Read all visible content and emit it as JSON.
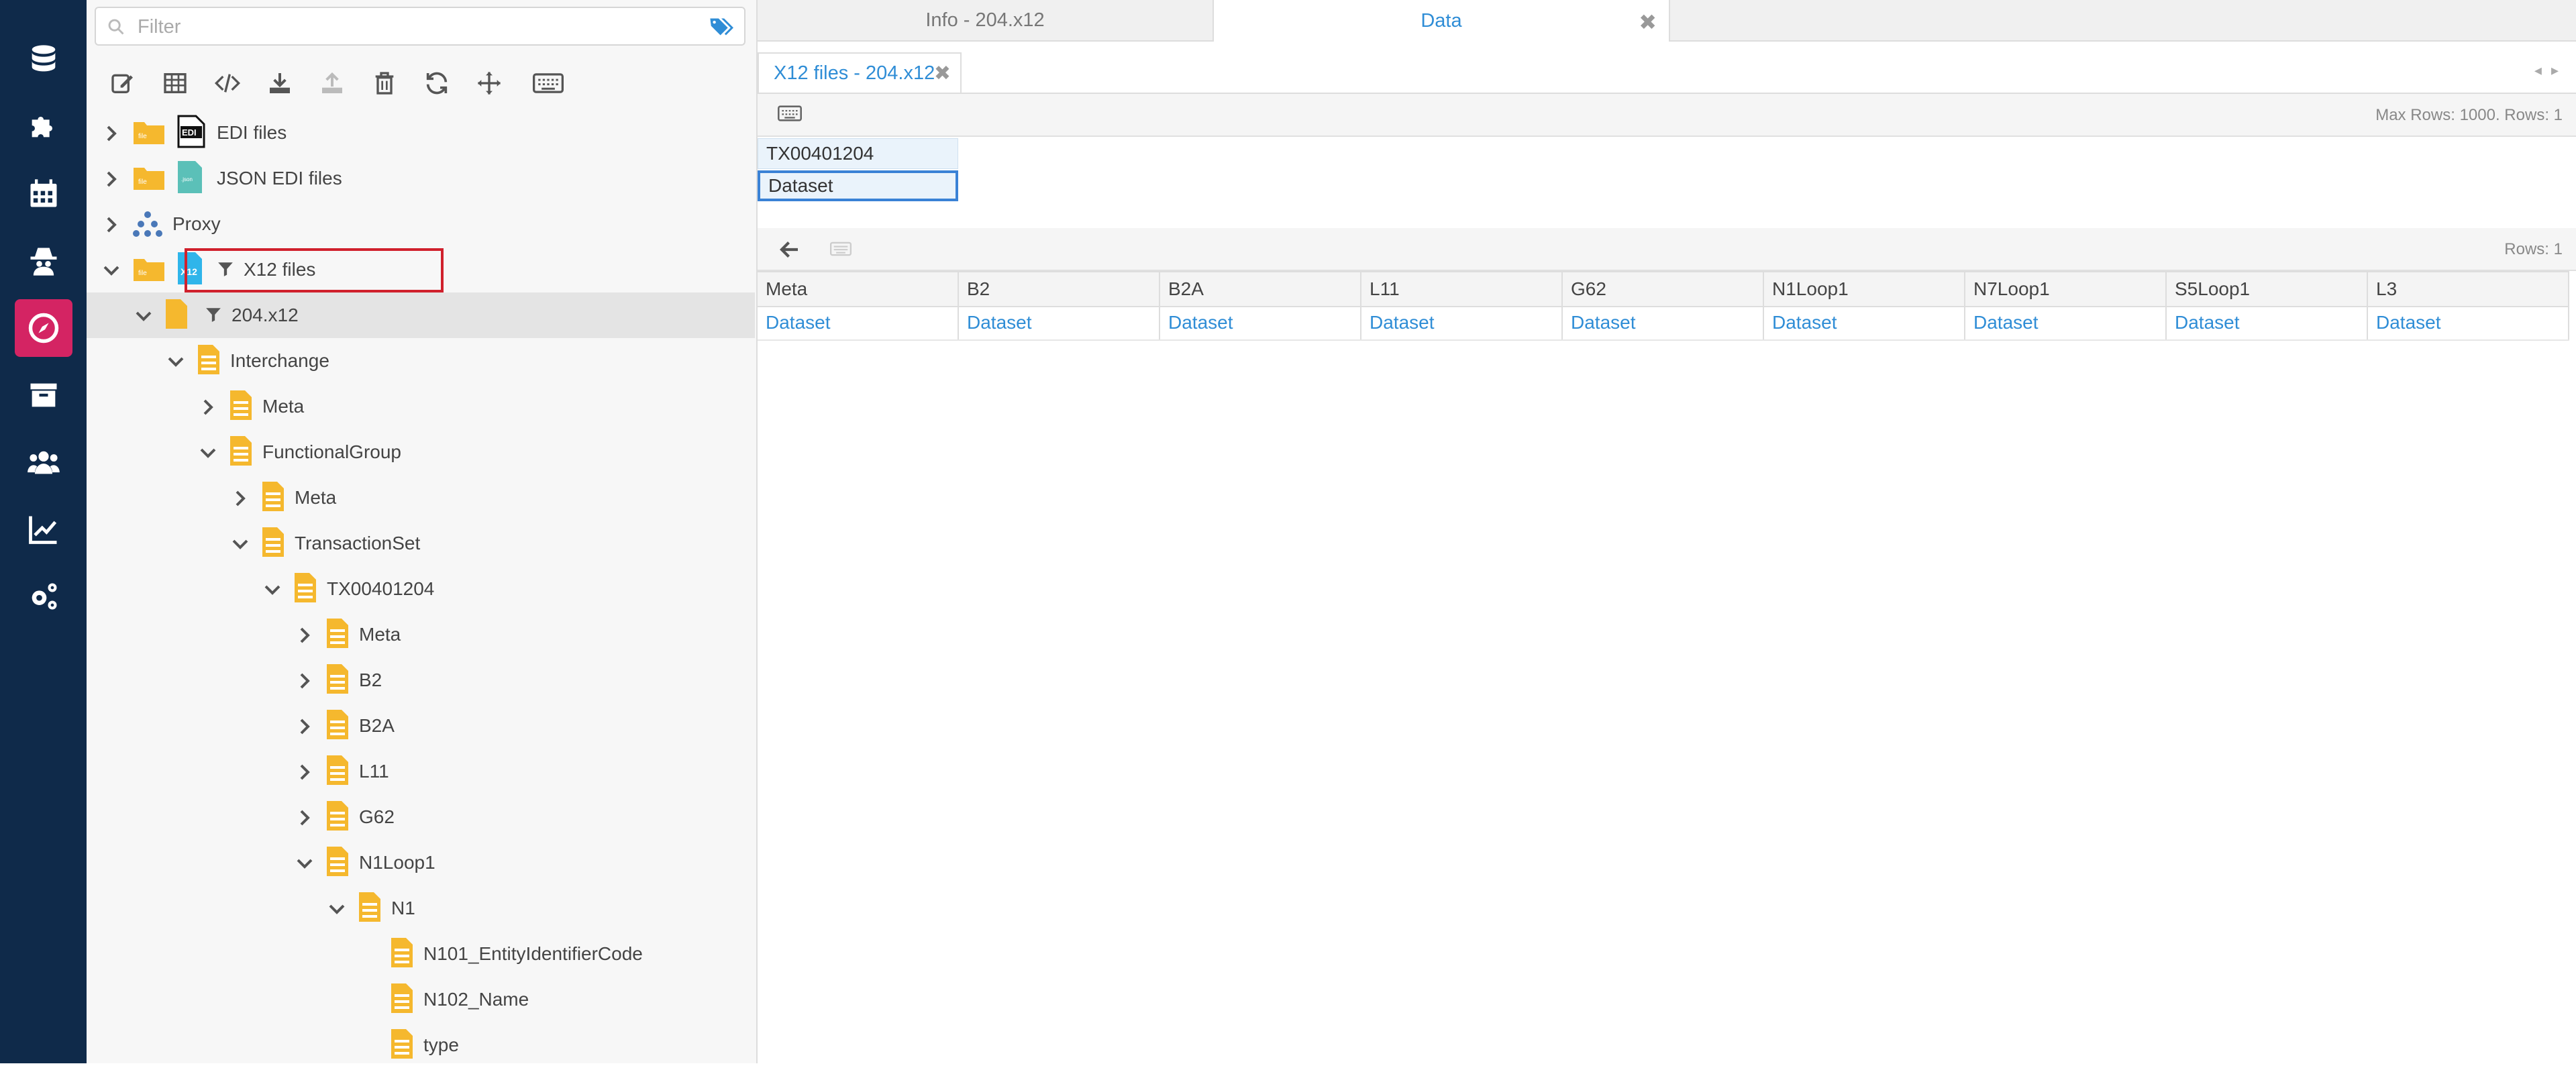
{
  "colors": {
    "nav_bg": "#0f2a4a",
    "nav_active": "#d42463",
    "link_blue": "#2f8dd6",
    "folder": "#f5b82e",
    "highlight": "#d0202c"
  },
  "nav": {
    "items": [
      {
        "icon": "database-icon",
        "active": false
      },
      {
        "icon": "puzzle-icon",
        "active": false
      },
      {
        "icon": "calendar-icon",
        "active": false
      },
      {
        "icon": "spy-icon",
        "active": false
      },
      {
        "icon": "compass-icon",
        "active": true
      },
      {
        "icon": "archive-icon",
        "active": false
      },
      {
        "icon": "users-icon",
        "active": false
      },
      {
        "icon": "chart-line-icon",
        "active": false
      },
      {
        "icon": "gears-icon",
        "active": false
      }
    ]
  },
  "filter": {
    "placeholder": "Filter",
    "value": ""
  },
  "toolbar": {
    "buttons": [
      "edit-icon",
      "table-icon",
      "code-icon",
      "download-icon",
      "upload-icon",
      "trash-icon",
      "refresh-icon",
      "move-icon",
      "keyboard-icon"
    ]
  },
  "tree": {
    "rows": [
      {
        "label": "EDI files",
        "expanded": false,
        "type": "edi",
        "depth": 0
      },
      {
        "label": "JSON EDI files",
        "expanded": false,
        "type": "json",
        "depth": 0
      },
      {
        "label": "Proxy",
        "expanded": false,
        "type": "proxy",
        "depth": 0
      },
      {
        "label": "X12 files",
        "expanded": true,
        "type": "x12",
        "depth": 0,
        "highlighted": true
      },
      {
        "label": "204.x12",
        "expanded": true,
        "type": "file",
        "depth": 1,
        "selected": true
      },
      {
        "label": "Interchange",
        "expanded": true,
        "type": "node",
        "depth": 2
      },
      {
        "label": "Meta",
        "expanded": false,
        "type": "node",
        "depth": 3
      },
      {
        "label": "FunctionalGroup",
        "expanded": true,
        "type": "node",
        "depth": 3
      },
      {
        "label": "Meta",
        "expanded": false,
        "type": "node",
        "depth": 4
      },
      {
        "label": "TransactionSet",
        "expanded": true,
        "type": "node",
        "depth": 4
      },
      {
        "label": "TX00401204",
        "expanded": true,
        "type": "node",
        "depth": 5
      },
      {
        "label": "Meta",
        "expanded": false,
        "type": "node",
        "depth": 6
      },
      {
        "label": "B2",
        "expanded": false,
        "type": "node",
        "depth": 6
      },
      {
        "label": "B2A",
        "expanded": false,
        "type": "node",
        "depth": 6
      },
      {
        "label": "L11",
        "expanded": false,
        "type": "node",
        "depth": 6
      },
      {
        "label": "G62",
        "expanded": false,
        "type": "node",
        "depth": 6
      },
      {
        "label": "N1Loop1",
        "expanded": true,
        "type": "node",
        "depth": 6
      },
      {
        "label": "N1",
        "expanded": true,
        "type": "node",
        "depth": 7
      },
      {
        "label": "N101_EntityIdentifierCode",
        "type": "leaf",
        "depth": 8
      },
      {
        "label": "N102_Name",
        "type": "leaf",
        "depth": 8
      },
      {
        "label": "type",
        "type": "leaf",
        "depth": 8
      }
    ]
  },
  "top_tabs": [
    {
      "label": "Info - 204.x12",
      "active": false
    },
    {
      "label": "Data",
      "active": true
    }
  ],
  "sub_tab": {
    "label": "X12 files - 204.x12"
  },
  "grid_status": "Max Rows: 1000. Rows: 1",
  "dataset_list": [
    "TX00401204",
    "Dataset"
  ],
  "result_status": "Rows: 1",
  "result_grid": {
    "columns": [
      "Meta",
      "B2",
      "B2A",
      "L11",
      "G62",
      "N1Loop1",
      "N7Loop1",
      "S5Loop1",
      "L3"
    ],
    "rows": [
      [
        "Dataset",
        "Dataset",
        "Dataset",
        "Dataset",
        "Dataset",
        "Dataset",
        "Dataset",
        "Dataset",
        "Dataset"
      ]
    ]
  }
}
